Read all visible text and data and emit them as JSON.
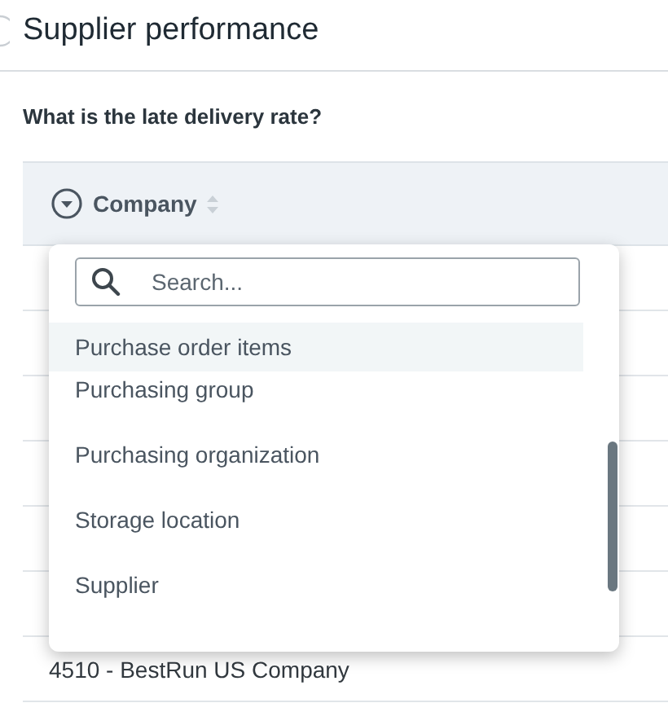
{
  "page": {
    "title": "Supplier performance"
  },
  "question": "What is the late delivery rate?",
  "table": {
    "columns": [
      {
        "label": "Company",
        "menu_open": true
      }
    ],
    "rows": [
      {
        "company": "4510 - BestRun US Company"
      }
    ]
  },
  "dropdown": {
    "search": {
      "placeholder": "Search..."
    },
    "items": [
      {
        "label": "Purchase order items",
        "selected": true
      },
      {
        "label": "Purchasing group",
        "selected": false
      },
      {
        "label": "Purchasing organization",
        "selected": false
      },
      {
        "label": "Storage location",
        "selected": false
      },
      {
        "label": "Supplier",
        "selected": false
      }
    ]
  }
}
